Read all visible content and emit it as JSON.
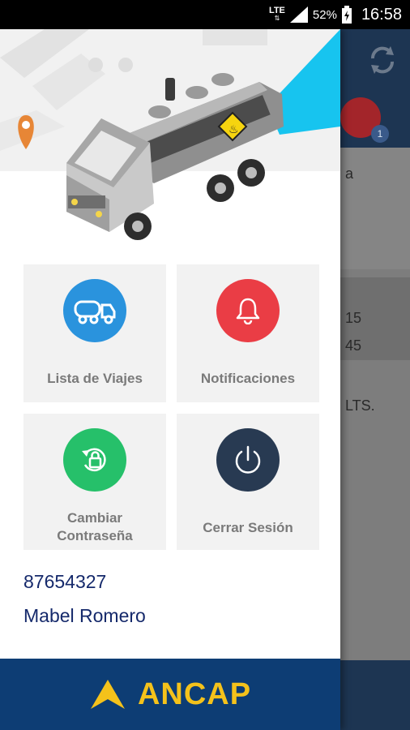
{
  "status_bar": {
    "network": "LTE",
    "network_sub": "⇅",
    "battery": "52%",
    "time": "16:58",
    "signal_icon": "signal-bars-icon",
    "battery_icon": "battery-charging-icon"
  },
  "background_app": {
    "snippet_1": "a",
    "snippet_2": "15",
    "snippet_3": "45",
    "snippet_4": "LTS.",
    "notification_count": "1"
  },
  "menu": {
    "tiles": [
      {
        "label": "Lista de Viajes",
        "icon": "tanker-truck-icon",
        "color": "#2a93dd"
      },
      {
        "label": "Notificaciones",
        "icon": "bell-icon",
        "color": "#ea3d45"
      },
      {
        "label": "Cambiar Contraseña",
        "icon": "lock-refresh-icon",
        "color": "#26c06a"
      },
      {
        "label": "Cerrar Sesión",
        "icon": "power-icon",
        "color": "#283a52"
      }
    ]
  },
  "user": {
    "id": "87654327",
    "name": "Mabel Romero"
  },
  "brand": {
    "name": "ANCAP",
    "accent": "#f4c21b",
    "bar_color": "#0d3d74"
  }
}
